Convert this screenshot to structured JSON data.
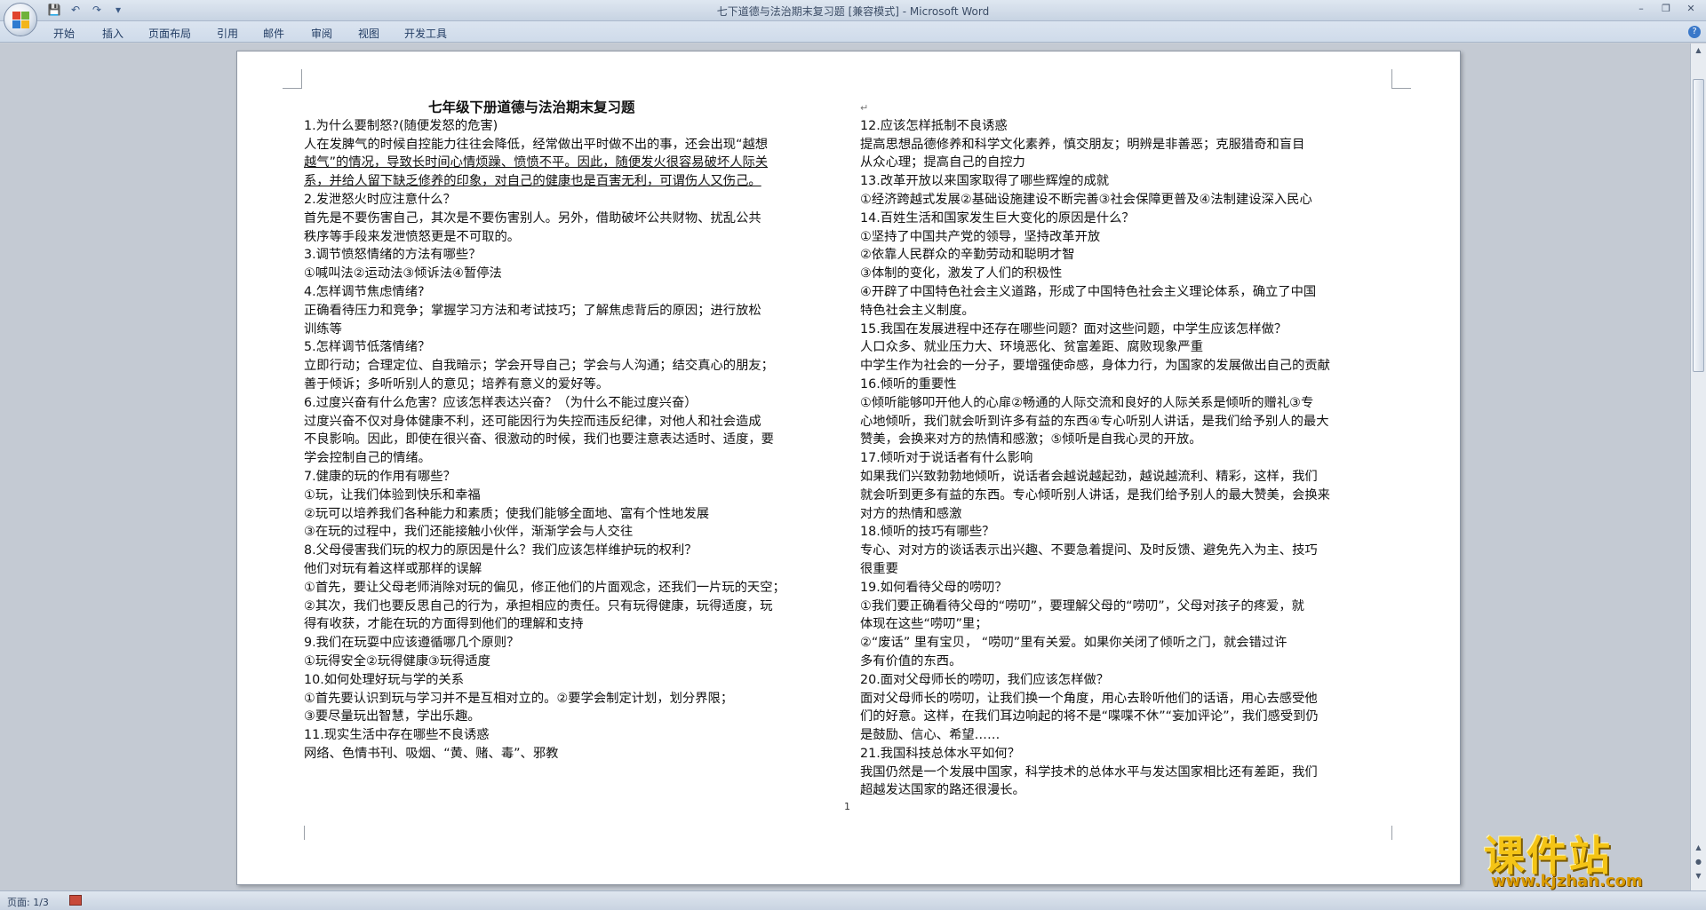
{
  "window": {
    "title": "七下道德与法治期末复习题 [兼容模式] - Microsoft Word",
    "qat": [
      "save-icon",
      "undo-icon",
      "redo-icon",
      "customize-icon"
    ]
  },
  "ribbon": {
    "tabs": [
      "开始",
      "插入",
      "页面布局",
      "引用",
      "邮件",
      "审阅",
      "视图",
      "开发工具"
    ]
  },
  "document": {
    "title": "七年级下册道德与法治期末复习题",
    "left_lines": [
      "1.为什么要制怒?(随便发怒的危害)",
      " 人在发脾气的时候自控能力往往会降低，经常做出平时做不出的事，还会出现“越想",
      "越气”的情况，导致长时间心情烦躁、愤愤不平。因此，随便发火很容易破坏人际关",
      "系，并给人留下缺乏修养的印象，对自己的健康也是百害无利，可谓伤人又伤己。",
      "2.发泄怒火时应注意什么？",
      "   首先是不要伤害自己，其次是不要伤害别人。另外，借助破坏公共财物、扰乱公共",
      "秩序等手段来发泄愤怒更是不可取的。",
      "3.调节愤怒情绪的方法有哪些？",
      "   ①喊叫法②运动法③倾诉法④暂停法",
      "4.怎样调节焦虑情绪?",
      "   正确看待压力和竞争；掌握学习方法和考试技巧；了解焦虑背后的原因；进行放松",
      "训练等",
      "5.怎样调节低落情绪？",
      "   立即行动；合理定位、自我暗示；学会开导自己；学会与人沟通；结交真心的朋友；",
      "善于倾诉；多听听别人的意见；培养有意义的爱好等。",
      "6.过度兴奋有什么危害？应该怎样表达兴奋？（为什么不能过度兴奋）",
      "   过度兴奋不仅对身体健康不利，还可能因行为失控而违反纪律，对他人和社会造成",
      "不良影响。因此，即使在很兴奋、很激动的时候，我们也要注意表达适时、适度，要",
      "学会控制自己的情绪。",
      "7.健康的玩的作用有哪些？",
      " ①玩，让我们体验到快乐和幸福",
      " ②玩可以培养我们各种能力和素质；使我们能够全面地、富有个性地发展",
      " ③在玩的过程中，我们还能接触小伙伴，渐渐学会与人交往",
      "8.父母侵害我们玩的权力的原因是什么？我们应该怎样维护玩的权利？",
      "   他们对玩有着这样或那样的误解",
      " ①首先，要让父母老师消除对玩的偏见，修正他们的片面观念，还我们一片玩的天空；",
      " ②其次，我们也要反思自己的行为，承担相应的责任。只有玩得健康，玩得适度，玩",
      "得有收获，才能在玩的方面得到他们的理解和支持",
      "9.我们在玩耍中应该遵循哪几个原则？",
      "   ①玩得安全②玩得健康③玩得适度",
      "10.如何处理好玩与学的关系",
      "   ①首先要认识到玩与学习并不是互相对立的。②要学会制定计划，划分界限；",
      "   ③要尽量玩出智慧，学出乐趣。",
      "11.现实生活中存在哪些不良诱惑",
      "    网络、色情书刊、吸烟、“黄、赌、毒”、邪教"
    ],
    "right_lines": [
      "12.应该怎样抵制不良诱惑",
      "     提高思想品德修养和科学文化素养，慎交朋友；明辨是非善恶；克服猎奇和盲目",
      "从众心理；提高自己的自控力",
      "13.改革开放以来国家取得了哪些辉煌的成就",
      "   ①经济跨越式发展②基础设施建设不断完善③社会保障更普及④法制建设深入民心",
      "14.百姓生活和国家发生巨大变化的原因是什么？",
      "   ①坚持了中国共产党的领导，坚持改革开放",
      "   ②依靠人民群众的辛勤劳动和聪明才智",
      "   ③体制的变化，激发了人们的积极性",
      "   ④开辟了中国特色社会主义道路，形成了中国特色社会主义理论体系，确立了中国",
      "   特色社会主义制度。",
      "15.我国在发展进程中还存在哪些问题？面对这些问题，中学生应该怎样做？",
      "   人口众多、就业压力大、环境恶化、贫富差距、腐败现象严重",
      "  中学生作为社会的一分子，要增强使命感，身体力行，为国家的发展做出自己的贡献",
      "16.倾听的重要性",
      "   ①倾听能够叩开他人的心扉②畅通的人际交流和良好的人际关系是倾听的赠礼③专",
      "心地倾听，我们就会听到许多有益的东西④专心听别人讲话，是我们给予别人的最大",
      "赞美，会换来对方的热情和感激；⑤倾听是自我心灵的开放。",
      "17.倾听对于说话者有什么影响",
      "     如果我们兴致勃勃地倾听，说话者会越说越起劲，越说越流利、精彩，这样，我们",
      "就会听到更多有益的东西。专心倾听别人讲话，是我们给予别人的最大赞美，会换来",
      "对方的热情和感激",
      "18.倾听的技巧有哪些？",
      "     专心、对对方的谈话表示出兴趣、不要急着提问、及时反馈、避免先入为主、技巧",
      "很重要",
      "19.如何看待父母的唠叨？",
      "   ①我们要正确看待父母的“唠叨”，要理解父母的“唠叨”，父母对孩子的疼爱，就",
      "  体现在这些“唠叨”里；",
      "   ②“废话” 里有宝贝，  “唠叨”里有关爱。如果你关闭了倾听之门，就会错过许",
      "  多有价值的东西。",
      "20.面对父母师长的唠叨，我们应该怎样做？",
      "     面对父母师长的唠叨，让我们换一个角度，用心去聆听他们的话语，用心去感受他",
      "们的好意。这样，在我们耳边响起的将不是“喋喋不休”“妄加评论”，我们感受到仍",
      "是鼓励、信心、希望……",
      "21.我国科技总体水平如何？",
      "    我国仍然是一个发展中国家，科学技术的总体水平与发达国家相比还有差距，我们",
      "超越发达国家的路还很漫长。"
    ],
    "page_number": "1"
  },
  "statusbar": {
    "page_info": "页面: 1/3"
  },
  "watermark": {
    "cn": "课件站",
    "url": "www.kjzhan.com"
  }
}
